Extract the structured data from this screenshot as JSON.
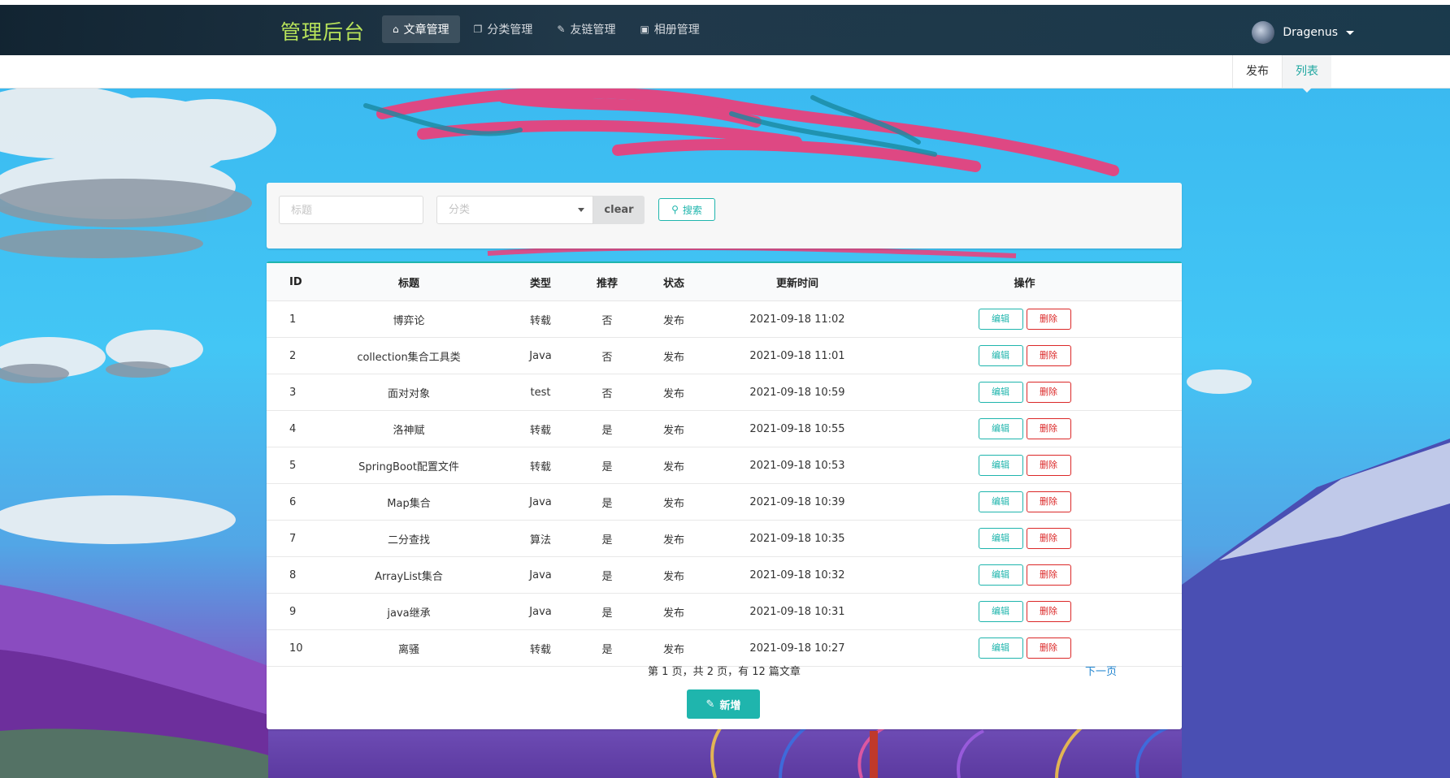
{
  "app": {
    "brand": "管理后台"
  },
  "nav": {
    "items": [
      {
        "label": "文章管理",
        "icon": "home-icon",
        "active": true
      },
      {
        "label": "分类管理",
        "icon": "copy-icon",
        "active": false
      },
      {
        "label": "友链管理",
        "icon": "pencil-icon",
        "active": false
      },
      {
        "label": "相册管理",
        "icon": "image-icon",
        "active": false
      }
    ],
    "user": {
      "name": "Dragenus"
    }
  },
  "subnav": {
    "tabs": [
      {
        "label": "发布",
        "active": false
      },
      {
        "label": "列表",
        "active": true
      }
    ]
  },
  "search": {
    "title_placeholder": "标题",
    "category_placeholder": "分类",
    "clear_label": "clear",
    "search_label": "搜索"
  },
  "table": {
    "headers": [
      "ID",
      "标题",
      "类型",
      "推荐",
      "状态",
      "更新时间",
      "操作"
    ],
    "edit_label": "编辑",
    "delete_label": "删除",
    "rows": [
      {
        "id": "1",
        "title": "博弈论",
        "type": "转载",
        "recommend": "否",
        "status": "发布",
        "updated": "2021-09-18 11:02"
      },
      {
        "id": "2",
        "title": "collection集合工具类",
        "type": "Java",
        "recommend": "否",
        "status": "发布",
        "updated": "2021-09-18 11:01"
      },
      {
        "id": "3",
        "title": "面对对象",
        "type": "test",
        "recommend": "否",
        "status": "发布",
        "updated": "2021-09-18 10:59"
      },
      {
        "id": "4",
        "title": "洛神赋",
        "type": "转载",
        "recommend": "是",
        "status": "发布",
        "updated": "2021-09-18 10:55"
      },
      {
        "id": "5",
        "title": "SpringBoot配置文件",
        "type": "转载",
        "recommend": "是",
        "status": "发布",
        "updated": "2021-09-18 10:53"
      },
      {
        "id": "6",
        "title": "Map集合",
        "type": "Java",
        "recommend": "是",
        "status": "发布",
        "updated": "2021-09-18 10:39"
      },
      {
        "id": "7",
        "title": "二分查找",
        "type": "算法",
        "recommend": "是",
        "status": "发布",
        "updated": "2021-09-18 10:35"
      },
      {
        "id": "8",
        "title": "ArrayList集合",
        "type": "Java",
        "recommend": "是",
        "status": "发布",
        "updated": "2021-09-18 10:32"
      },
      {
        "id": "9",
        "title": "java继承",
        "type": "Java",
        "recommend": "是",
        "status": "发布",
        "updated": "2021-09-18 10:31"
      },
      {
        "id": "10",
        "title": "离骚",
        "type": "转载",
        "recommend": "是",
        "status": "发布",
        "updated": "2021-09-18 10:27"
      }
    ]
  },
  "pagination": {
    "info": "第 1 页，共 2 页，有 12 篇文章",
    "next_label": "下一页"
  },
  "actions": {
    "add_label": "新增"
  },
  "colors": {
    "accent": "#1fb5ad",
    "danger": "#db2828",
    "brand": "#b7e25a",
    "link": "#2185d0"
  }
}
